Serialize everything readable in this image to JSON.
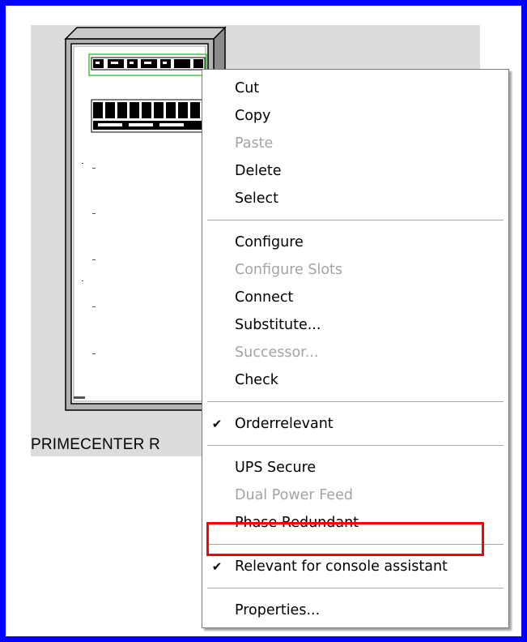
{
  "device": {
    "label": "PRIMECENTER R"
  },
  "context_menu": {
    "groups": [
      [
        {
          "label": "Cut",
          "enabled": true,
          "checked": false
        },
        {
          "label": "Copy",
          "enabled": true,
          "checked": false
        },
        {
          "label": "Paste",
          "enabled": false,
          "checked": false
        },
        {
          "label": "Delete",
          "enabled": true,
          "checked": false
        },
        {
          "label": "Select",
          "enabled": true,
          "checked": false
        }
      ],
      [
        {
          "label": "Configure",
          "enabled": true,
          "checked": false
        },
        {
          "label": "Configure Slots",
          "enabled": false,
          "checked": false
        },
        {
          "label": "Connect",
          "enabled": true,
          "checked": false
        },
        {
          "label": "Substitute...",
          "enabled": true,
          "checked": false
        },
        {
          "label": "Successor...",
          "enabled": false,
          "checked": false
        },
        {
          "label": "Check",
          "enabled": true,
          "checked": false
        }
      ],
      [
        {
          "label": "Orderrelevant",
          "enabled": true,
          "checked": true
        }
      ],
      [
        {
          "label": "UPS Secure",
          "enabled": true,
          "checked": false
        },
        {
          "label": "Dual Power Feed",
          "enabled": false,
          "checked": false
        },
        {
          "label": "Phase Redundant",
          "enabled": true,
          "checked": false
        }
      ],
      [
        {
          "label": "Relevant for console assistant",
          "enabled": true,
          "checked": true
        }
      ],
      [
        {
          "label": "Properties...",
          "enabled": true,
          "checked": false
        }
      ]
    ],
    "check_glyph": "✔"
  },
  "colors": {
    "frame_border": "#0000ff",
    "highlight_border": "#ff0000",
    "disabled_text": "#a3a3a3",
    "canvas_background": "#dcdcdc"
  }
}
